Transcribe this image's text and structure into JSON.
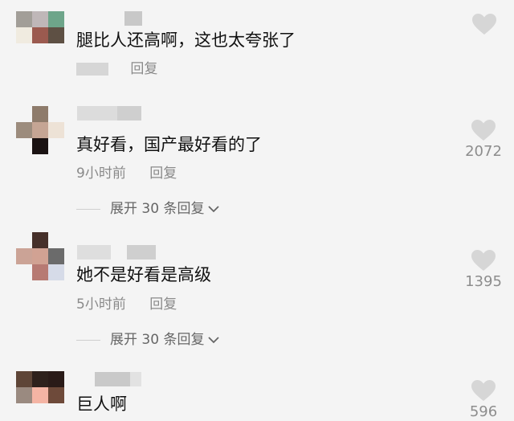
{
  "comments": [
    {
      "text": "腿比人还高啊，这也太夸张了",
      "time": "",
      "reply": "回复",
      "likes": "",
      "expand": "",
      "colors": {
        "avatar": [
          "#a29e98",
          "#bfb7b8",
          "#6ea58a",
          "#f0ebe0",
          "#9b5a4f",
          "#5e5044",
          "#f4f4f4",
          "#f4f4f4",
          "#f4f4f4"
        ]
      }
    },
    {
      "text": "真好看，国产最好看的了",
      "time": "9小时前",
      "reply": "回复",
      "likes": "2072",
      "expand": "展开 30 条回复",
      "colors": {
        "avatar": [
          "#f4f4f4",
          "#8e7b6b",
          "#f4f4f4",
          "#9c8c7d",
          "#c5a594",
          "#ede2d6",
          "#f4f4f4",
          "#1a1212",
          "#f4f4f4"
        ]
      }
    },
    {
      "text": "她不是好看是高级",
      "time": "5小时前",
      "reply": "回复",
      "likes": "1395",
      "expand": "展开 30 条回复",
      "colors": {
        "avatar": [
          "#f4f4f4",
          "#46302a",
          "#f4f4f4",
          "#cba396",
          "#d1a293",
          "#6b6b6b",
          "#f4f4f4",
          "#b77a73",
          "#d6dbe8"
        ]
      }
    },
    {
      "text": "巨人啊",
      "time": "",
      "reply": "",
      "likes": "596",
      "expand": "",
      "colors": {
        "avatar": [
          "#5e4537",
          "#2e211c",
          "#2a1b18",
          "#9a8a80",
          "#f4b4a4",
          "#6e4a3a",
          "#f4f4f4",
          "#f4f4f4",
          "#f4f4f4"
        ]
      }
    }
  ],
  "icons": {
    "like": "heart-icon",
    "expand": "chevron-down-icon"
  },
  "colors": {
    "background": "#f4f4f4",
    "meta": "#8a8a8a",
    "heart": "#d6d6d6"
  }
}
